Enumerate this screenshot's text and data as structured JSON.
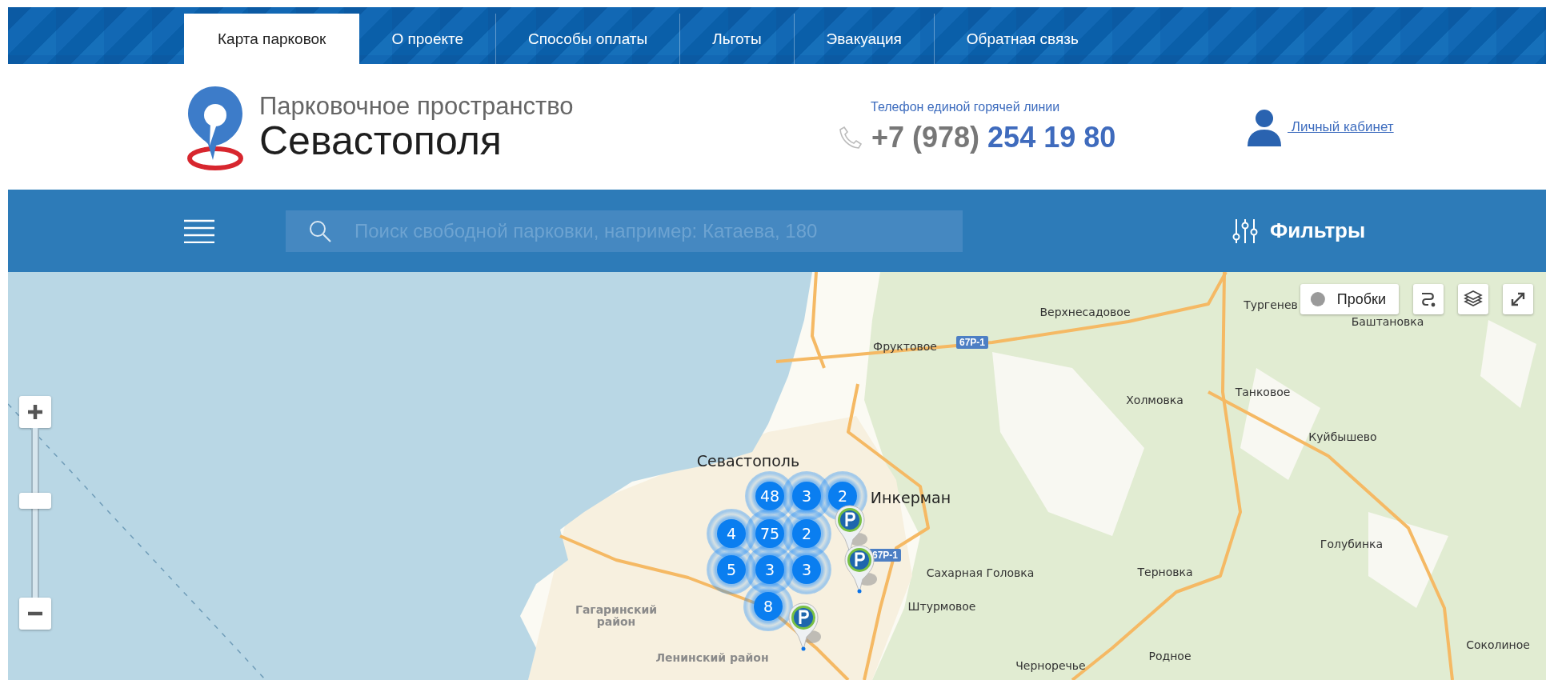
{
  "nav": {
    "tabs": [
      {
        "label": "Карта парковок",
        "selected": true
      },
      {
        "label": "О проекте",
        "selected": false
      },
      {
        "label": "Способы оплаты",
        "selected": false
      },
      {
        "label": "Льготы",
        "selected": false
      },
      {
        "label": "Эвакуация",
        "selected": false
      },
      {
        "label": "Обратная связь",
        "selected": false
      }
    ]
  },
  "header": {
    "logo": {
      "line1": "Парковочное пространство",
      "line2": "Севастополя"
    },
    "hotline": {
      "label": "Телефон единой горячей линии",
      "code": "+7 (978)",
      "number": "254 19 80"
    },
    "account_link": " Личный кабинет"
  },
  "toolbar": {
    "search": {
      "placeholder": "Поиск свободной парковки, например: Катаева, 180"
    },
    "filters": "Фильтры"
  },
  "map": {
    "traffic_button": "Пробки",
    "zoom": {
      "level": 0.57
    },
    "labels": [
      {
        "text": "Фруктовое",
        "kind": "village"
      },
      {
        "text": "Верхнесадовое",
        "kind": "village"
      },
      {
        "text": "Тургенев",
        "kind": "village"
      },
      {
        "text": "Баштановка",
        "kind": "village"
      },
      {
        "text": "Холмовка",
        "kind": "village"
      },
      {
        "text": "Танковое",
        "kind": "village"
      },
      {
        "text": "Куйбышево",
        "kind": "village"
      },
      {
        "text": "Севастополь",
        "kind": "city"
      },
      {
        "text": "Инкерман",
        "kind": "city"
      },
      {
        "text": "Сахарная Головка",
        "kind": "village"
      },
      {
        "text": "Голубинка",
        "kind": "village"
      },
      {
        "text": "Терновка",
        "kind": "village"
      },
      {
        "text": "Штурмовое",
        "kind": "village"
      },
      {
        "text": "Родное",
        "kind": "village"
      },
      {
        "text": "Черноречье",
        "kind": "village"
      },
      {
        "text": "Соколиное",
        "kind": "village"
      },
      {
        "text": "Гагаринский район",
        "kind": "district"
      },
      {
        "text": "Ленинский район",
        "kind": "district"
      }
    ],
    "road_badges": [
      "67Р-1",
      "67Р-1"
    ],
    "clusters": [
      "48",
      "3",
      "2",
      "4",
      "75",
      "2",
      "5",
      "3",
      "3",
      "8"
    ]
  }
}
